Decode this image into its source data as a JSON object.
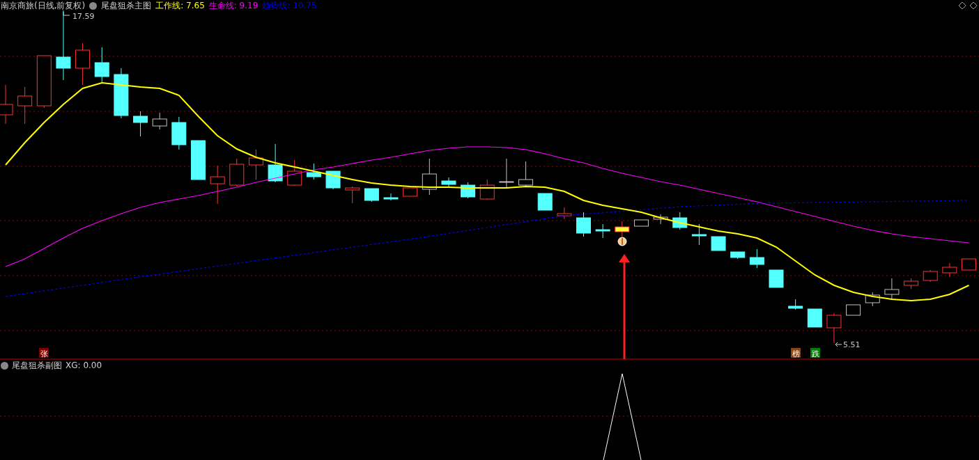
{
  "main_panel": {
    "title": "南京商旅(日线,前复权)",
    "indicator": "尾盘狙杀主图",
    "lines": [
      {
        "label": "工作线: 7.65",
        "color": "#ffff00"
      },
      {
        "label": "生命线: 9.19",
        "color": "#ff00ff"
      },
      {
        "label": "趋势线: 10.75",
        "color": "#0000ff"
      }
    ],
    "high_label": "17.59",
    "low_label": "5.51",
    "marks": [
      {
        "text": "张",
        "color": "#800000"
      },
      {
        "text": "榜",
        "color": "#8b4513"
      },
      {
        "text": "跌",
        "color": "#008000"
      }
    ]
  },
  "sub_panel": {
    "indicator": "尾盘狙杀副图",
    "value": "XG: 0.00"
  }
}
